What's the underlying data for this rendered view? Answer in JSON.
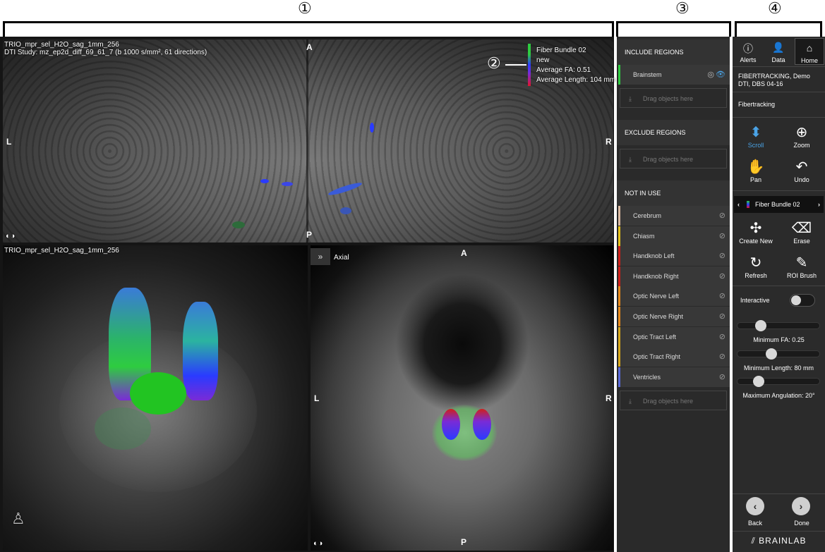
{
  "callouts": [
    "①",
    "②",
    "③",
    "④"
  ],
  "views": {
    "top": {
      "line1": "TRIO_mpr_sel_H2O_sag_1mm_256",
      "line2": "DTI Study: mz_ep2d_diff_69_61_7 (b 1000 s/mm², 61 directions)",
      "orient_a": "A",
      "orient_p": "P",
      "orient_l": "L",
      "orient_r": "R",
      "legend": {
        "name": "Fiber Bundle 02",
        "status": "new",
        "fa": "Average FA: 0.51",
        "length": "Average Length: 104 mm"
      }
    },
    "threed": {
      "label": "TRIO_mpr_sel_H2O_sag_1mm_256"
    },
    "axial": {
      "toggle": "»",
      "label": "Axial",
      "orient_a": "A",
      "orient_p": "P",
      "orient_l": "L",
      "orient_r": "R"
    }
  },
  "regions": {
    "include_title": "INCLUDE REGIONS",
    "include_items": [
      {
        "label": "Brainstem",
        "color": "#2ecc40"
      }
    ],
    "exclude_title": "EXCLUDE REGIONS",
    "not_in_use_title": "NOT IN USE",
    "not_in_use_items": [
      {
        "label": "Cerebrum",
        "color": "#d9b9a0"
      },
      {
        "label": "Chiasm",
        "color": "#e6c21a"
      },
      {
        "label": "Handknob Left",
        "color": "#d0201a"
      },
      {
        "label": "Handknob Right",
        "color": "#d0201a"
      },
      {
        "label": "Optic Nerve Left",
        "color": "#e8891a"
      },
      {
        "label": "Optic Nerve Right",
        "color": "#e8891a"
      },
      {
        "label": "Optic Tract Left",
        "color": "#d8a81a"
      },
      {
        "label": "Optic Tract Right",
        "color": "#d8a81a"
      },
      {
        "label": "Ventricles",
        "color": "#5a6ad8"
      }
    ],
    "drag_text": "Drag objects here"
  },
  "panel": {
    "tabs": [
      "Alerts",
      "Data",
      "Home"
    ],
    "patient_line1": "FIBERTRACKING, Demo",
    "patient_line2": "DTI, DBS 04-16",
    "mode": "Fibertracking",
    "tools": [
      "Scroll",
      "Zoom",
      "Pan",
      "Undo"
    ],
    "bundle_selector": "Fiber Bundle 02",
    "bundle_tools": [
      "Create New",
      "Erase",
      "Refresh",
      "ROI Brush"
    ],
    "interactive_label": "Interactive",
    "interactive_on": false,
    "sliders": [
      {
        "label": "Minimum FA: 0.25",
        "value": 0.25,
        "max": 1.0
      },
      {
        "label": "Minimum Length: 80 mm",
        "value": 80,
        "max": 200
      },
      {
        "label": "Maximum Angulation: 20°",
        "value": 20,
        "max": 90
      }
    ],
    "back_label": "Back",
    "done_label": "Done",
    "brand": "BRAINLAB",
    "accent": "#4aa3e6"
  }
}
